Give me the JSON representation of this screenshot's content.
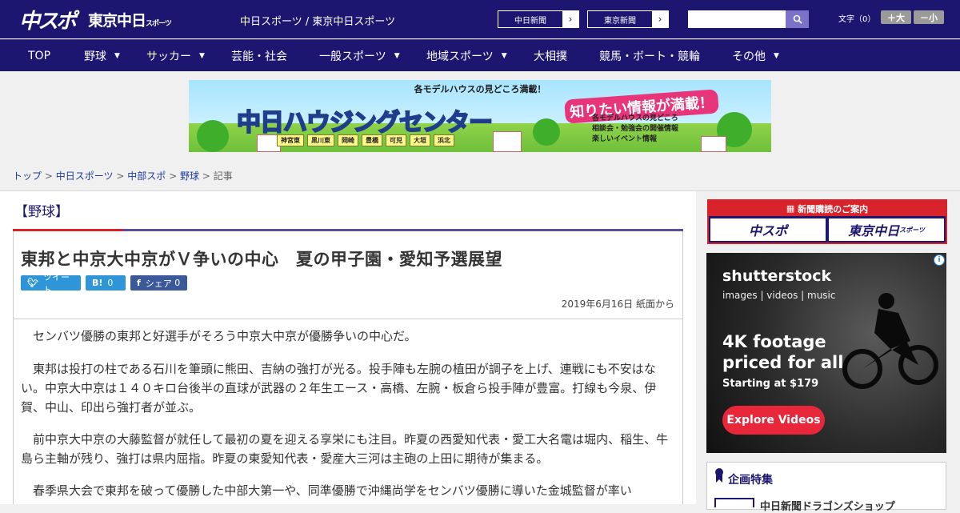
{
  "header": {
    "logo_primary": "中スポ",
    "logo_secondary": "東京中日",
    "logo_secondary_small": "スポーツ",
    "site_title": "中日スポーツ / 東京中日スポーツ",
    "paper_links": [
      "中日新聞",
      "東京新聞"
    ],
    "font_size_label": "文字（0）",
    "font_larger": "＋大",
    "font_smaller": "－小",
    "search_placeholder": ""
  },
  "nav": {
    "items": [
      {
        "label": "TOP",
        "has_menu": false
      },
      {
        "label": "野球",
        "has_menu": true
      },
      {
        "label": "サッカー",
        "has_menu": true
      },
      {
        "label": "芸能・社会",
        "has_menu": false
      },
      {
        "label": "一般スポーツ",
        "has_menu": true
      },
      {
        "label": "地域スポーツ",
        "has_menu": true
      },
      {
        "label": "大相撲",
        "has_menu": false
      },
      {
        "label": "競馬・ボート・競輪",
        "has_menu": false
      },
      {
        "label": "その他",
        "has_menu": true
      }
    ]
  },
  "banner": {
    "top_text": "各モデルハウスの見どころ満載！",
    "main_text": "中日ハウジングセンター",
    "right_text": "知りたい情報が満載！",
    "list": [
      "各モデルハウスの見どころ",
      "相談会・勉強会の開催情報",
      "楽しいイベント情報"
    ],
    "cities": [
      "神宮東",
      "黒川東",
      "岡崎",
      "豊橋",
      "可児",
      "大垣",
      "浜北"
    ]
  },
  "breadcrumb": {
    "items": [
      "トップ",
      "中日スポーツ",
      "中部スポ",
      "野球"
    ],
    "current": "記事",
    "separator": ">"
  },
  "article": {
    "section": "【野球】",
    "headline": "東邦と中京大中京がＶ争いの中心　夏の甲子園・愛知予選展望",
    "share": {
      "tweet": "ツイート",
      "hatena_icon": "B!",
      "hatena_count": "0",
      "facebook_label": "シェア",
      "facebook_count": "0"
    },
    "date": "2019年6月16日 紙面から",
    "paragraphs": [
      "　センバツ優勝の東邦と好選手がそろう中京大中京が優勝争いの中心だ。",
      "　東邦は投打の柱である石川を筆頭に熊田、吉納の強打が光る。投手陣も左腕の植田が調子を上げ、連戦にも不安はない。中京大中京は１４０キロ台後半の直球が武器の２年生エース・高橋、左腕・板倉ら投手陣が豊富。打線も今泉、伊賀、中山、印出ら強打者が並ぶ。",
      "　前中京大中京の大藤監督が就任して最初の夏を迎える享栄にも注目。昨夏の西愛知代表・愛工大名電は堀内、稲生、牛島ら主軸が残り、強打は県内屈指。昨夏の東愛知代表・愛産大三河は主砲の上田に期待が集まる。",
      "　春季県大会で東邦を破って優勝した中部大第一や、同準優勝で沖縄尚学をセンバツ優勝に導いた金城監督が率い"
    ]
  },
  "sidebar": {
    "subscription_title": "新聞購読のご案内",
    "subscription_links": [
      "中スポ",
      "東京中日"
    ],
    "subscription_small": "スポーツ",
    "ad": {
      "brand": "shutterstock",
      "sub": "images  |  videos  |  music",
      "headline_1": "4K footage",
      "headline_2": "priced for all",
      "price": "Starting at $179",
      "cta": "Explore Videos"
    },
    "feature_title": "企画特集",
    "feature_item": "中日新聞ドラゴンズショップ"
  },
  "colors": {
    "brand_navy": "#1d1670",
    "accent_red": "#d8222c",
    "share_blue": "#2e95d8"
  }
}
